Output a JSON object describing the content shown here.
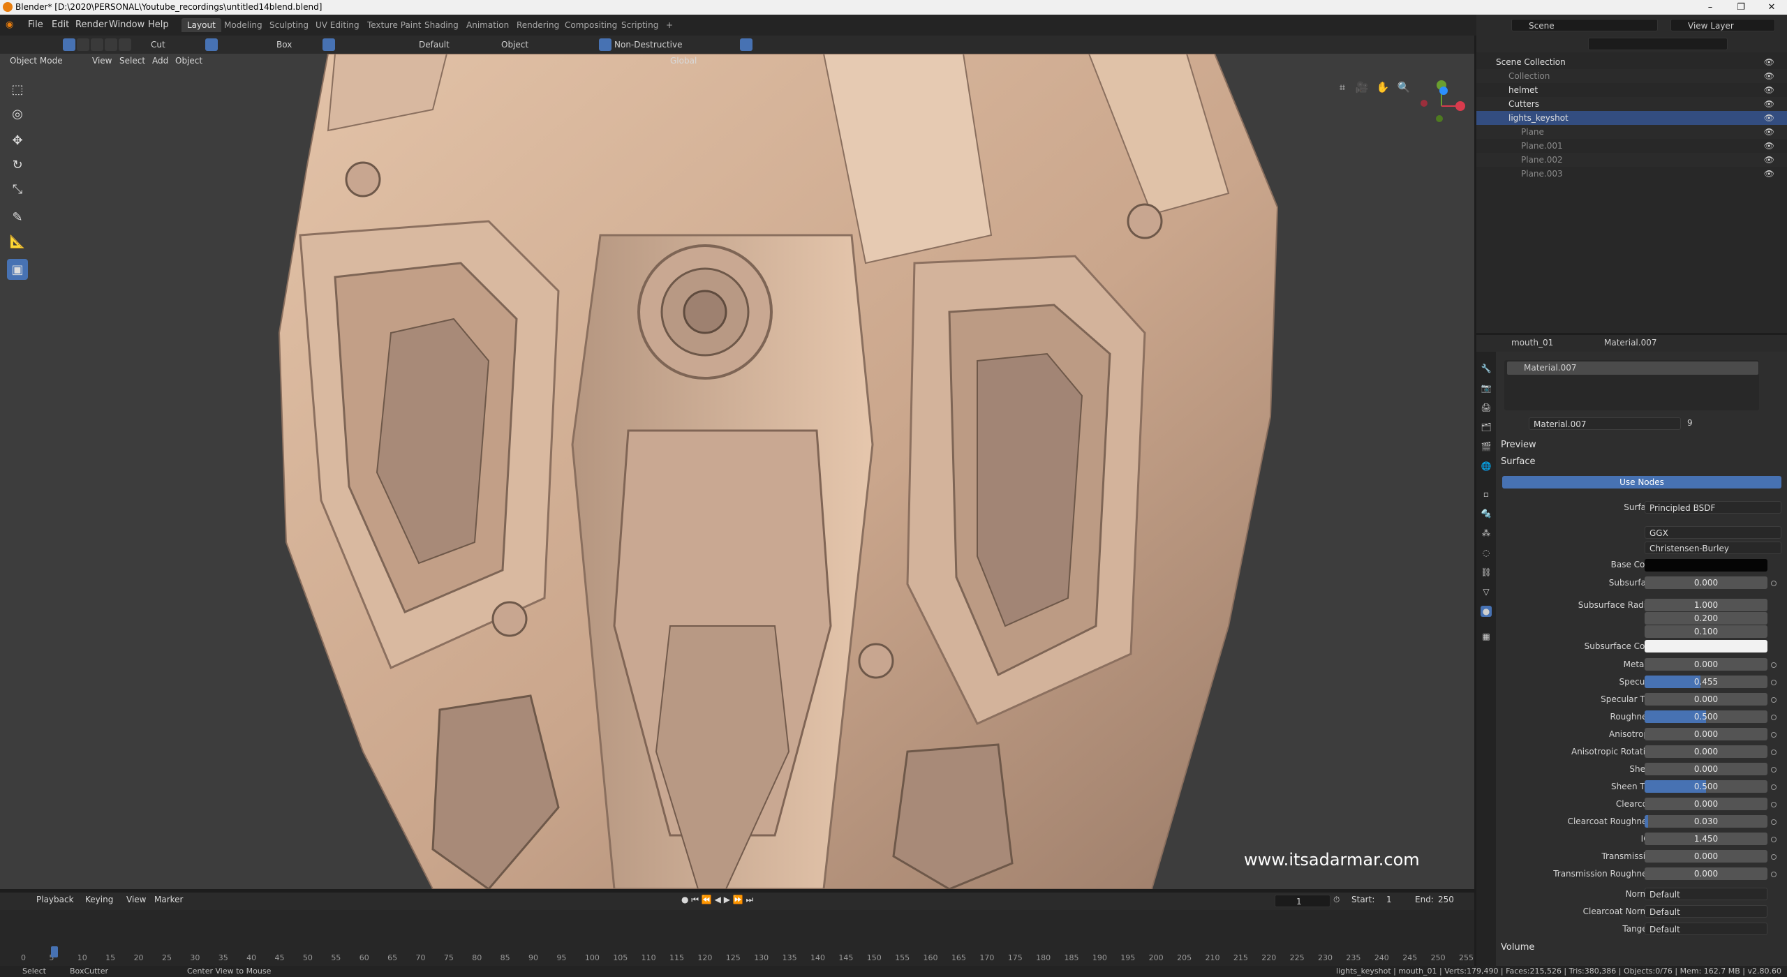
{
  "titlebar": {
    "title": "Blender* [D:\\2020\\PERSONAL\\Youtube_recordings\\untitled14blend.blend]",
    "minimize": "–",
    "maximize": "❐",
    "close": "✕"
  },
  "menu": {
    "file": "File",
    "edit": "Edit",
    "render": "Render",
    "window": "Window",
    "help": "Help"
  },
  "workspaces": [
    "Layout",
    "Modeling",
    "Sculpting",
    "UV Editing",
    "Texture Paint",
    "Shading",
    "Animation",
    "Rendering",
    "Compositing",
    "Scripting"
  ],
  "workspace_add": "+",
  "scene": {
    "label": "Scene",
    "view_layer": "View Layer"
  },
  "tool_settings": {
    "cut": "Cut",
    "box": "Box",
    "default": "Default",
    "object": "Object",
    "non_destructive": "Non-Destructive",
    "global": "Global"
  },
  "viewport_header": {
    "mode": "Object Mode",
    "view": "View",
    "select": "Select",
    "add": "Add",
    "object": "Object"
  },
  "watermark": "www.itsadarmar.com",
  "timeline": {
    "playback": "Playback",
    "keying": "Keying",
    "view": "View",
    "marker": "Marker",
    "current_frame": "1",
    "start_label": "Start:",
    "start": "1",
    "end_label": "End:",
    "end": "250",
    "ticks": [
      "0",
      "5",
      "10",
      "15",
      "20",
      "25",
      "30",
      "35",
      "40",
      "45",
      "50",
      "55",
      "60",
      "65",
      "70",
      "75",
      "80",
      "85",
      "90",
      "95",
      "100",
      "105",
      "110",
      "115",
      "120",
      "125",
      "130",
      "135",
      "140",
      "145",
      "150",
      "155",
      "160",
      "165",
      "170",
      "175",
      "180",
      "185",
      "190",
      "195",
      "200",
      "205",
      "210",
      "215",
      "220",
      "225",
      "230",
      "235",
      "240",
      "245",
      "250",
      "255"
    ]
  },
  "statusbar": {
    "select": "Select",
    "boxcutter": "BoxCutter",
    "center": "Center View to Mouse",
    "stats": "lights_keyshot | mouth_01 | Verts:179,490 | Faces:215,526 | Tris:380,386 | Objects:0/76 | Mem: 162.7 MB | v2.80.60"
  },
  "outliner": {
    "rows": [
      {
        "label": "Scene Collection",
        "indent": 0,
        "dim": false
      },
      {
        "label": "Collection",
        "indent": 1,
        "dim": true
      },
      {
        "label": "helmet",
        "indent": 1,
        "dim": false
      },
      {
        "label": "Cutters",
        "indent": 1,
        "dim": false
      },
      {
        "label": "lights_keyshot",
        "indent": 1,
        "dim": false
      },
      {
        "label": "Plane",
        "indent": 2,
        "dim": true
      },
      {
        "label": "Plane.001",
        "indent": 2,
        "dim": true
      },
      {
        "label": "Plane.002",
        "indent": 2,
        "dim": true
      },
      {
        "label": "Plane.003",
        "indent": 2,
        "dim": true
      }
    ]
  },
  "properties": {
    "object": "mouth_01",
    "material": "Material.007",
    "slot": "Material.007",
    "material_field": "Material.007",
    "users": "9",
    "preview": "Preview",
    "surface_section": "Surface",
    "use_nodes": "Use Nodes",
    "surface_label": "Surface",
    "surface_value": "Principled BSDF",
    "distribution": "GGX",
    "subsurface_method": "Christensen-Burley",
    "base_color_label": "Base Color",
    "subsurface_radius_label": "Subsurface Radius",
    "subsurface_radius": [
      "1.000",
      "0.200",
      "0.100"
    ],
    "subsurface_color_label": "Subsurface Color",
    "fields": [
      {
        "label": "Subsurface",
        "value": "0.000",
        "fill": 0
      },
      {
        "label": "Metallic",
        "value": "0.000",
        "fill": 0
      },
      {
        "label": "Specular",
        "value": "0.455",
        "fill": 0.455
      },
      {
        "label": "Specular Tint",
        "value": "0.000",
        "fill": 0
      },
      {
        "label": "Roughness",
        "value": "0.500",
        "fill": 0.5
      },
      {
        "label": "Anisotropic",
        "value": "0.000",
        "fill": 0
      },
      {
        "label": "Anisotropic Rotation",
        "value": "0.000",
        "fill": 0
      },
      {
        "label": "Sheen",
        "value": "0.000",
        "fill": 0
      },
      {
        "label": "Sheen Tint",
        "value": "0.500",
        "fill": 0.5
      },
      {
        "label": "Clearcoat",
        "value": "0.000",
        "fill": 0
      },
      {
        "label": "Clearcoat Roughness",
        "value": "0.030",
        "fill": 0.03
      },
      {
        "label": "IOR",
        "value": "1.450",
        "fill": 0
      },
      {
        "label": "Transmission",
        "value": "0.000",
        "fill": 0
      },
      {
        "label": "Transmission Roughness",
        "value": "0.000",
        "fill": 0
      }
    ],
    "normal_label": "Normal",
    "normal": "Default",
    "clearcoat_normal_label": "Clearcoat Normal",
    "clearcoat_normal": "Default",
    "tangent_label": "Tangent",
    "tangent": "Default",
    "volume": "Volume"
  },
  "colors": {
    "accent": "#4772b3",
    "model": "#d7b59c",
    "bg": "#3d3d3d"
  }
}
